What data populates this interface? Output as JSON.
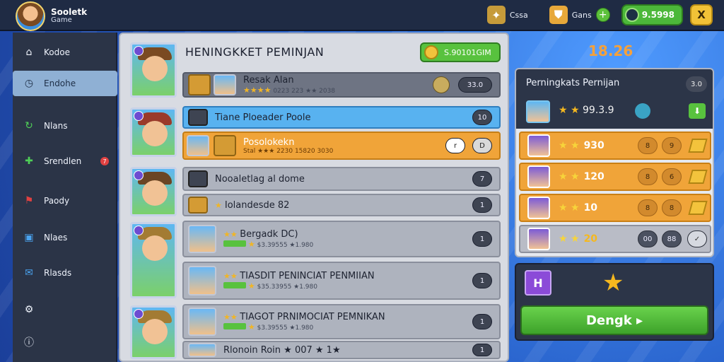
{
  "brand": {
    "title": "Sooletk",
    "subtitle": "Game"
  },
  "topbar": {
    "item1_label": "Cssa",
    "item2_label": "Gans",
    "coins": "9.5998",
    "close_label": "X"
  },
  "sidebar": {
    "items": [
      {
        "label": "Kodoe",
        "icon": "home-icon"
      },
      {
        "label": "Endohe",
        "icon": "clock-icon"
      },
      {
        "label": "Nlans",
        "icon": "refresh-icon"
      },
      {
        "label": "Srendlen",
        "icon": "puzzle-icon",
        "badge": "7"
      },
      {
        "label": "Paody",
        "icon": "flag-icon"
      },
      {
        "label": "Nlaes",
        "icon": "square-icon"
      },
      {
        "label": "Rlasds",
        "icon": "mail-icon"
      },
      {
        "label": "",
        "icon": "gear-icon"
      },
      {
        "label": "",
        "icon": "info-icon"
      }
    ]
  },
  "main": {
    "title": "HENINGKKET PEMINJAN",
    "top_button": "S.90101GIM",
    "rows": [
      {
        "line1": {
          "title": "Resak Alan",
          "stars": "★★★★",
          "stats": "0223 223 ★★ 2038",
          "pill": "33.0"
        }
      },
      {
        "line1": {
          "title": "Tiane Ploeader Poole",
          "pill": "10"
        },
        "line2": {
          "title": "Posolokekn",
          "stats": "Stal ★★★ 2230 15820 3030",
          "pill1": "r",
          "pill2": "D"
        }
      },
      {
        "line1": {
          "title": "Nooaletlag al dome",
          "pill": "7"
        },
        "line2": {
          "title": "Iolandesde 82",
          "pill": "1"
        }
      },
      {
        "line1": {
          "title": "Bergadk DC)",
          "stats": "$3.39555 ★1.980",
          "pill": "1"
        }
      },
      {
        "line1": {
          "title": "TIASDIT PENINCIAT PENMIIAN",
          "stats": "$35.33955 ★1.980",
          "pill": "1"
        }
      },
      {
        "line1": {
          "title": "TIAGOT PRNIMOCIAT PEMNIKAN",
          "stats": "$3.39555 ★1.980",
          "pill": "1"
        },
        "line2": {
          "title": "Rlonoin Roin ★ 007 ★ 1★",
          "pill": "1"
        }
      }
    ]
  },
  "right": {
    "score": "18.26",
    "panel_title": "Perningkats Pernijan",
    "panel_pill": "3.0",
    "player_score": "99.3.9",
    "ranks": [
      {
        "value": "930",
        "p1": "8",
        "p2": "9"
      },
      {
        "value": "120",
        "p1": "8",
        "p2": "6"
      },
      {
        "value": "10",
        "p1": "8",
        "p2": "8"
      },
      {
        "value": "20",
        "p1": "00",
        "p2": "88"
      }
    ],
    "cta_label": "Dengk ▸"
  },
  "colors": {
    "accent_green": "#58c23e",
    "accent_orange": "#f0a439",
    "gold": "#f3c33c"
  }
}
